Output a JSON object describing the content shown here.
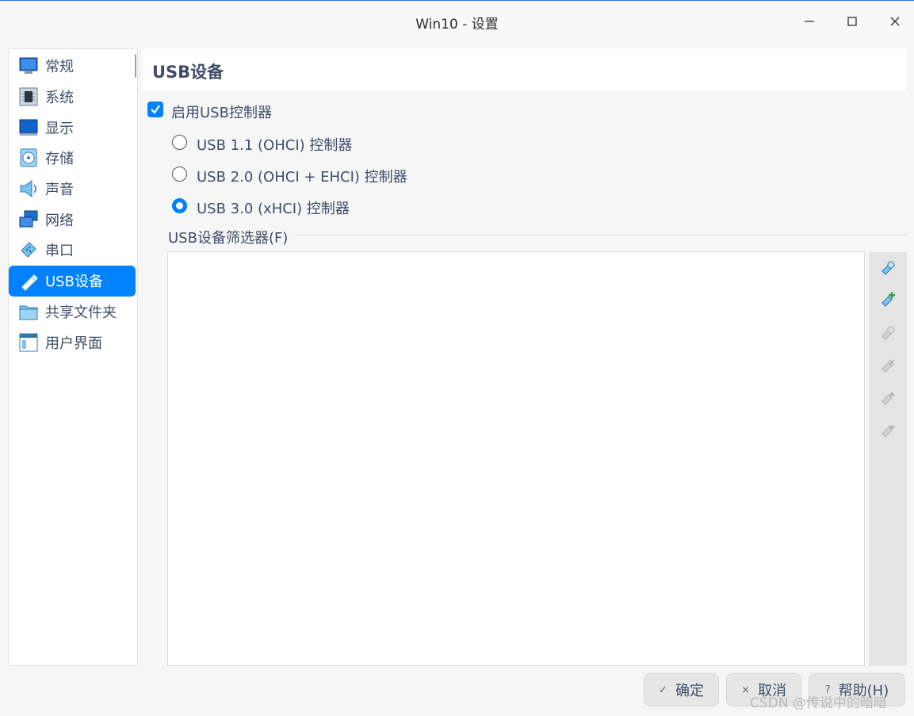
{
  "window": {
    "title": "Win10 - 设置",
    "minimize_glyph": "—",
    "maximize_glyph": "☐",
    "close_glyph": "✕"
  },
  "sidebar": {
    "items": [
      {
        "label": "常规",
        "icon": "general-icon"
      },
      {
        "label": "系统",
        "icon": "system-chip-icon"
      },
      {
        "label": "显示",
        "icon": "display-monitor-icon"
      },
      {
        "label": "存储",
        "icon": "storage-disk-icon"
      },
      {
        "label": "声音",
        "icon": "speaker-icon"
      },
      {
        "label": "网络",
        "icon": "network-icon"
      },
      {
        "label": "串口",
        "icon": "serial-port-icon"
      },
      {
        "label": "USB设备",
        "icon": "usb-icon",
        "active": true
      },
      {
        "label": "共享文件夹",
        "icon": "shared-folder-icon"
      },
      {
        "label": "用户界面",
        "icon": "user-interface-icon"
      }
    ]
  },
  "page": {
    "title": "USB设备",
    "enable_usb": {
      "label": "启用USB控制器",
      "checked": true
    },
    "controllers": [
      {
        "label": "USB 1.1 (OHCI) 控制器",
        "selected": false
      },
      {
        "label": "USB 2.0 (OHCI + EHCI) 控制器",
        "selected": false
      },
      {
        "label": "USB 3.0 (xHCI) 控制器",
        "selected": true
      }
    ],
    "filters": {
      "label": "USB设备筛选器(F)",
      "items": [],
      "toolbar": [
        {
          "icon": "add-empty-filter-icon",
          "enabled": true
        },
        {
          "icon": "add-filter-from-device-icon",
          "enabled": true
        },
        {
          "icon": "edit-filter-icon",
          "enabled": false
        },
        {
          "icon": "remove-filter-icon",
          "enabled": false
        },
        {
          "icon": "move-filter-up-icon",
          "enabled": false
        },
        {
          "icon": "move-filter-down-icon",
          "enabled": false
        }
      ]
    }
  },
  "buttons": {
    "ok": {
      "label": "确定",
      "glyph": "✓"
    },
    "cancel": {
      "label": "取消",
      "glyph": "×"
    },
    "help": {
      "label": "帮助(H)",
      "glyph": "?"
    }
  },
  "watermark": "CSDN @传说中的暗暗",
  "colors": {
    "accent": "#0081ff",
    "text": "#414d68",
    "background": "#f6f6f6"
  }
}
